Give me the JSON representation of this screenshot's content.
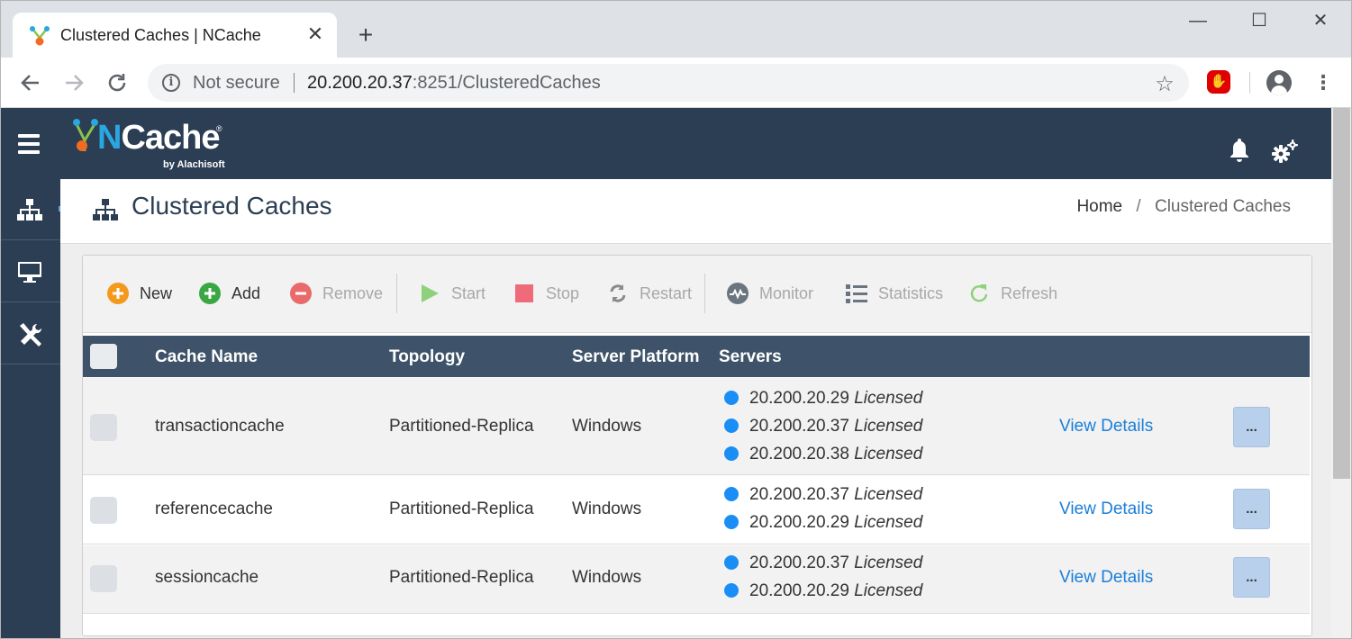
{
  "browser": {
    "tab_title": "Clustered Caches | NCache",
    "tab_close": "✕",
    "new_tab": "+",
    "window_minimize": "—",
    "window_maximize": "☐",
    "window_close": "✕",
    "not_secure": "Not secure",
    "url_host": "20.200.20.37",
    "url_path": ":8251/ClusteredCaches"
  },
  "header": {
    "logo_main": "Cache",
    "logo_n": "N",
    "logo_sub": "by Alachisoft",
    "logo_reg": "®"
  },
  "page": {
    "title": "Clustered Caches",
    "breadcrumb_home": "Home",
    "breadcrumb_sep": "/",
    "breadcrumb_current": "Clustered Caches"
  },
  "actions": {
    "new": "New",
    "add": "Add",
    "remove": "Remove",
    "start": "Start",
    "stop": "Stop",
    "restart": "Restart",
    "monitor": "Monitor",
    "statistics": "Statistics",
    "refresh": "Refresh"
  },
  "table": {
    "columns": {
      "cache_name": "Cache Name",
      "topology": "Topology",
      "server_platform": "Server Platform",
      "servers": "Servers"
    },
    "rows": [
      {
        "name": "transactioncache",
        "topology": "Partitioned-Replica",
        "platform": "Windows",
        "servers": [
          {
            "ip": "20.200.20.29",
            "status": "Licensed"
          },
          {
            "ip": "20.200.20.37",
            "status": "Licensed"
          },
          {
            "ip": "20.200.20.38",
            "status": "Licensed"
          }
        ],
        "link": "View Details",
        "more": "..."
      },
      {
        "name": "referencecache",
        "topology": "Partitioned-Replica",
        "platform": "Windows",
        "servers": [
          {
            "ip": "20.200.20.37",
            "status": "Licensed"
          },
          {
            "ip": "20.200.20.29",
            "status": "Licensed"
          }
        ],
        "link": "View Details",
        "more": "..."
      },
      {
        "name": "sessioncache",
        "topology": "Partitioned-Replica",
        "platform": "Windows",
        "servers": [
          {
            "ip": "20.200.20.37",
            "status": "Licensed"
          },
          {
            "ip": "20.200.20.29",
            "status": "Licensed"
          }
        ],
        "link": "View Details",
        "more": "..."
      }
    ]
  },
  "colors": {
    "header_bg": "#2c3e54",
    "table_head_bg": "#3e5369",
    "link": "#1b7ed8",
    "server_dot": "#1a8ef5",
    "new_icon": "#f39a1e",
    "add_icon": "#3aa745",
    "remove_icon": "#e86a6a",
    "start_icon": "#8fd17a",
    "stop_icon": "#ef6b7a",
    "refresh_icon": "#8fd17a"
  }
}
